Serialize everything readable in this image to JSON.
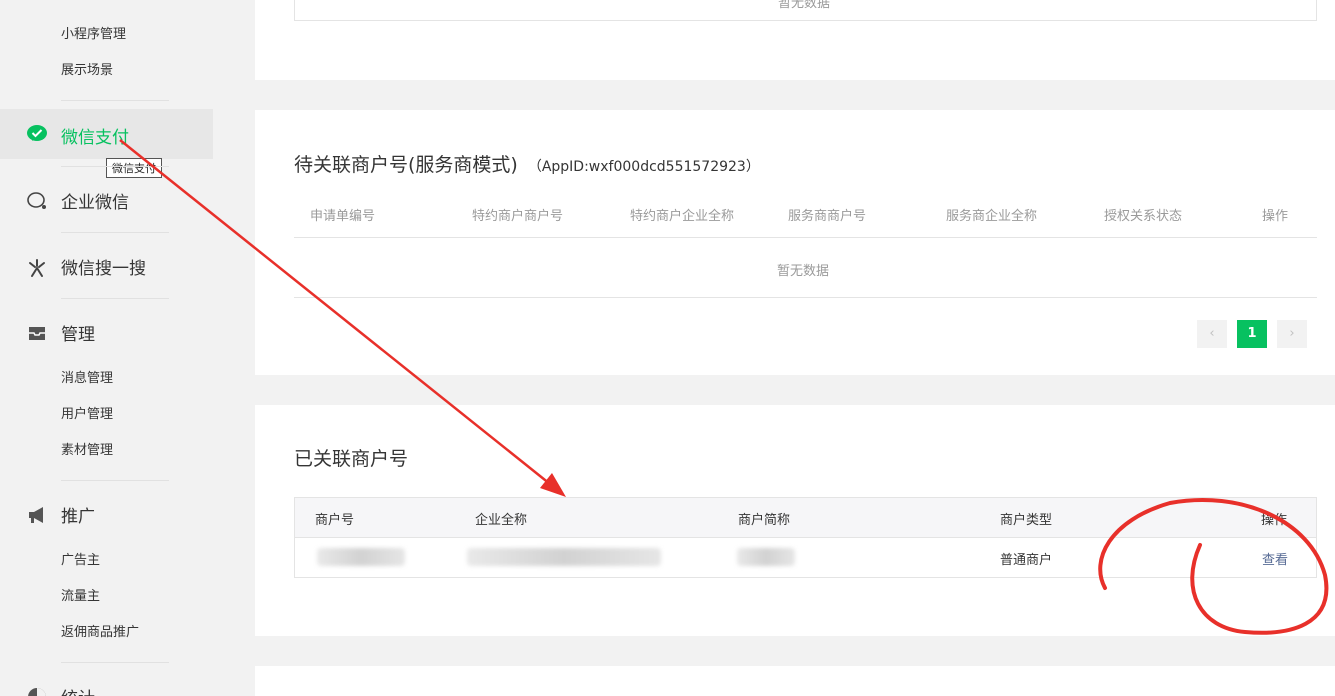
{
  "sidebar": {
    "items_top": [
      "小程序管理",
      "展示场景"
    ],
    "wechat_pay": "微信支付",
    "tooltip": "微信支付",
    "enterprise_wechat": "企业微信",
    "wechat_search": "微信搜一搜",
    "manage": "管理",
    "manage_items": [
      "消息管理",
      "用户管理",
      "素材管理"
    ],
    "promote": "推广",
    "promote_items": [
      "广告主",
      "流量主",
      "返佣商品推广"
    ],
    "stats": "统计"
  },
  "top_panel": {
    "empty_text": "暂无数据"
  },
  "pending_panel": {
    "title": "待关联商户号(服务商模式)",
    "appid": "（AppID:wxf000dcd551572923）",
    "columns": [
      "申请单编号",
      "特约商户商户号",
      "特约商户企业全称",
      "服务商商户号",
      "服务商企业全称",
      "授权关系状态",
      "操作"
    ],
    "empty_text": "暂无数据",
    "pager": {
      "prev": "‹",
      "current": "1",
      "next": "›"
    }
  },
  "linked_panel": {
    "title": "已关联商户号",
    "columns": [
      "商户号",
      "企业全称",
      "商户简称",
      "商户类型",
      "操作"
    ],
    "rows": [
      {
        "merchant_type": "普通商户",
        "action": "查看"
      }
    ]
  },
  "colors": {
    "accent": "#07c160",
    "link": "#576b95",
    "annotation": "#e8302a"
  }
}
